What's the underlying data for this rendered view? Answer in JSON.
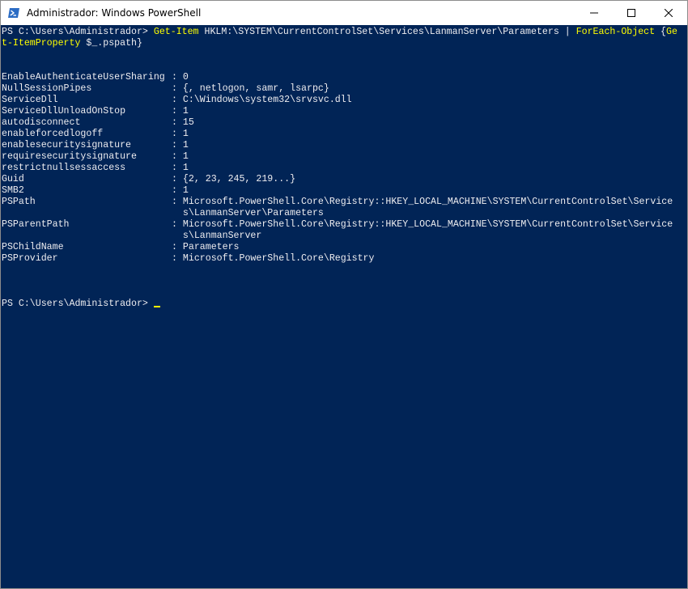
{
  "window": {
    "title": "Administrador: Windows PowerShell",
    "icon": "powershell-icon",
    "controls": [
      "minimize-icon",
      "maximize-icon",
      "close-icon"
    ]
  },
  "colors": {
    "console_bg": "#012456",
    "console_fg": "#eeedf0",
    "command_yellow": "#ffff00",
    "cursor": "#ffff00"
  },
  "command": {
    "prompt": "PS C:\\Users\\Administrador> ",
    "cmdlet1": "Get-Item",
    "arg1": " HKLM:\\SYSTEM\\CurrentControlSet\\Services\\LanmanServer\\Parameters | ",
    "cmdlet2": "ForEach-Object",
    "brace_open": " {",
    "cmdlet3_part1": "Ge",
    "cmdlet3_part2": "t-ItemProperty",
    "variable": " $_",
    "member": ".pspath}"
  },
  "output": [
    {
      "name": "EnableAuthenticateUserSharing",
      "value": "0"
    },
    {
      "name": "NullSessionPipes",
      "value": "{, netlogon, samr, lsarpc}"
    },
    {
      "name": "ServiceDll",
      "value": "C:\\Windows\\system32\\srvsvc.dll"
    },
    {
      "name": "ServiceDllUnloadOnStop",
      "value": "1"
    },
    {
      "name": "autodisconnect",
      "value": "15"
    },
    {
      "name": "enableforcedlogoff",
      "value": "1"
    },
    {
      "name": "enablesecuritysignature",
      "value": "1"
    },
    {
      "name": "requiresecuritysignature",
      "value": "1"
    },
    {
      "name": "restrictnullsessaccess",
      "value": "1"
    },
    {
      "name": "Guid",
      "value": "{2, 23, 245, 219...}"
    },
    {
      "name": "SMB2",
      "value": "1"
    },
    {
      "name": "PSPath",
      "value": "Microsoft.PowerShell.Core\\Registry::HKEY_LOCAL_MACHINE\\SYSTEM\\CurrentControlSet\\Service",
      "wrap": "s\\LanmanServer\\Parameters"
    },
    {
      "name": "PSParentPath",
      "value": "Microsoft.PowerShell.Core\\Registry::HKEY_LOCAL_MACHINE\\SYSTEM\\CurrentControlSet\\Service",
      "wrap": "s\\LanmanServer"
    },
    {
      "name": "PSChildName",
      "value": "Parameters"
    },
    {
      "name": "PSProvider",
      "value": "Microsoft.PowerShell.Core\\Registry"
    }
  ],
  "separator": ": ",
  "final_prompt": "PS C:\\Users\\Administrador> "
}
